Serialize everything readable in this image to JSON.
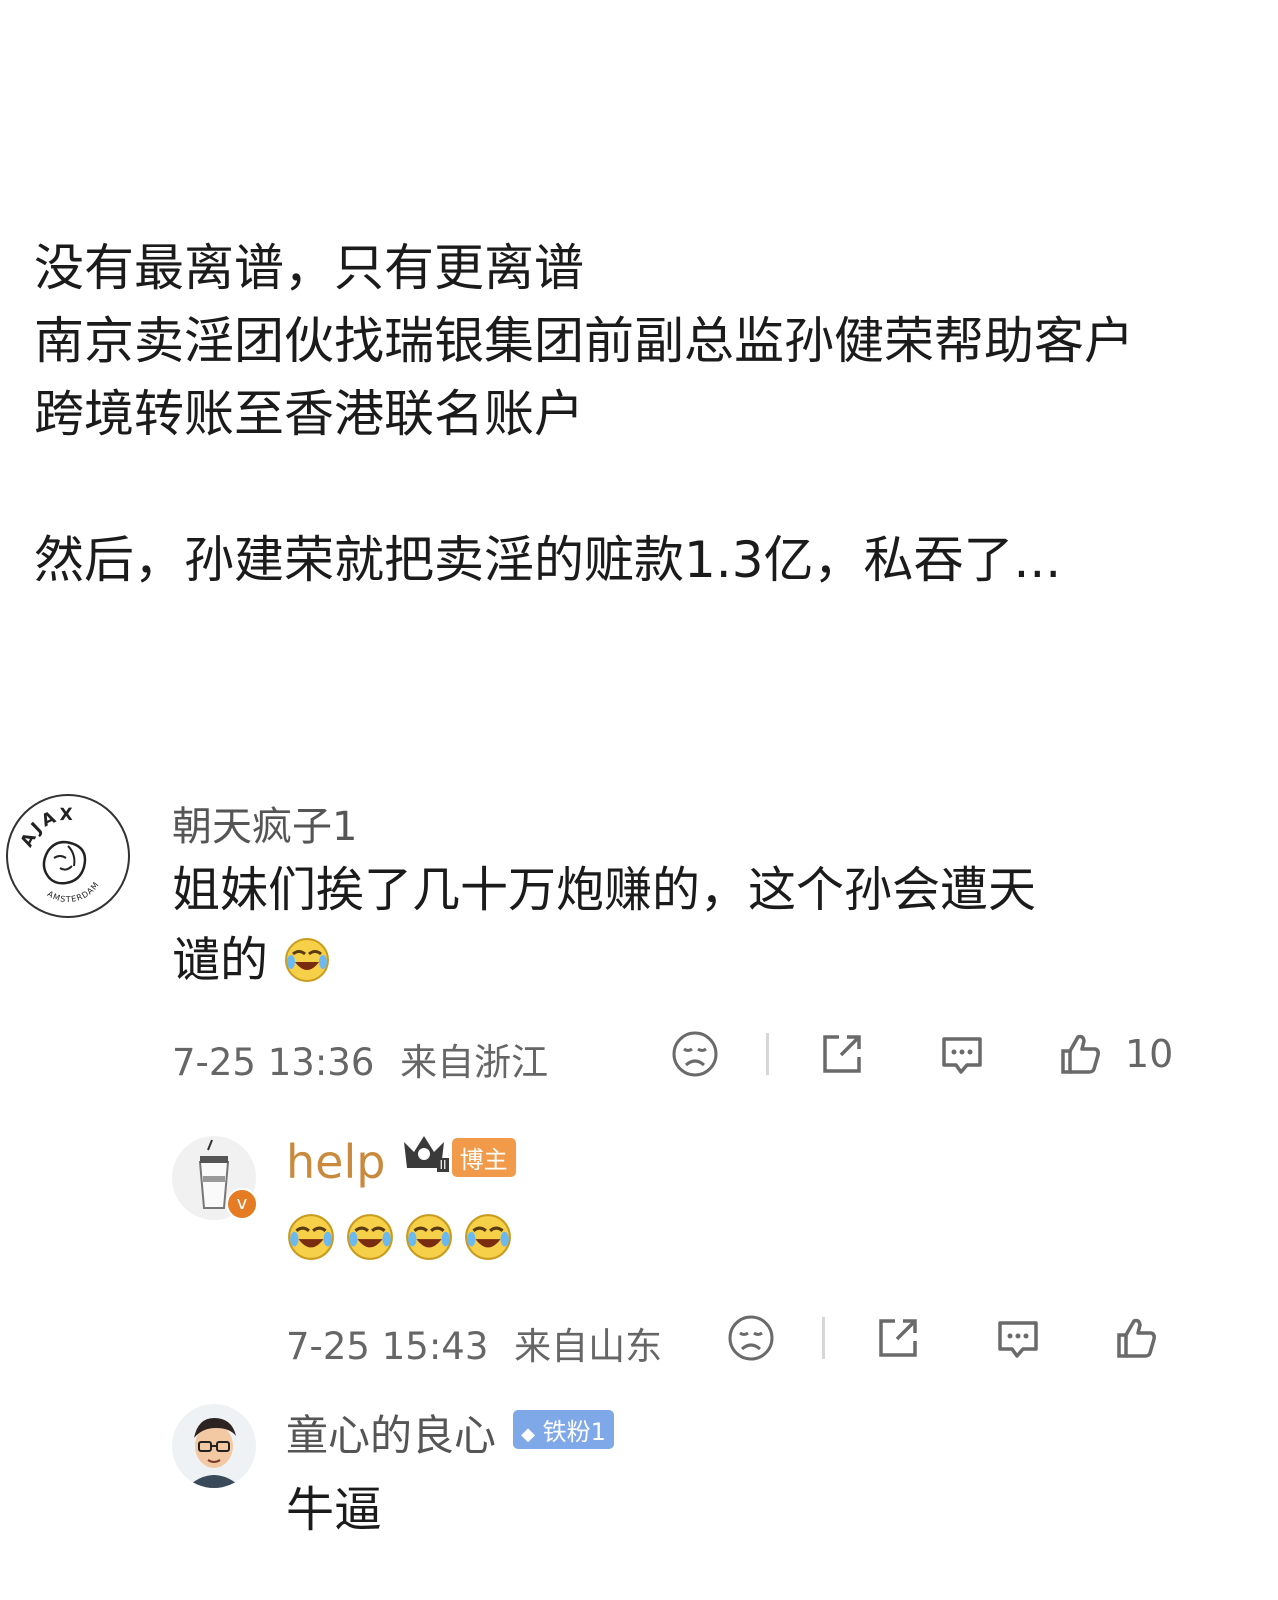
{
  "post": {
    "line1": "没有最离谱，只有更离谱",
    "line2": "南京卖淫团伙找瑞银集团前副总监孙健荣帮助客户",
    "line3": "跨境转账至香港联名账户",
    "line4": "然后，孙建荣就把卖淫的赃款1.3亿，私吞了..."
  },
  "comment1": {
    "avatar_icon": "ajax-logo-icon",
    "avatar_text_top": "AJAX",
    "avatar_text_bottom": "AMSTERDAM",
    "username": "朝天疯子1",
    "text_line1": "姐妹们挨了几十万炮赚的，这个孙会遭天",
    "text_line2": "谴的",
    "timestamp": "7-25 13:36",
    "location": "来自浙江",
    "like_count": "10"
  },
  "reply1": {
    "avatar_icon": "coffee-cup-avatar-icon",
    "username": "help",
    "badge": "博主",
    "crown_level": "II",
    "timestamp": "7-25 15:43",
    "location": "来自山东"
  },
  "reply2": {
    "avatar_icon": "cartoon-man-glasses-avatar-icon",
    "username": "童心的良心",
    "badge": "铁粉1",
    "text": "牛逼"
  },
  "colors": {
    "username_gray": "#555555",
    "host_name_orange": "#c98a3e",
    "badge_orange": "#f19a4a",
    "fan_badge_blue": "#7ea8e8",
    "icon_gray": "#6a6a6a"
  }
}
